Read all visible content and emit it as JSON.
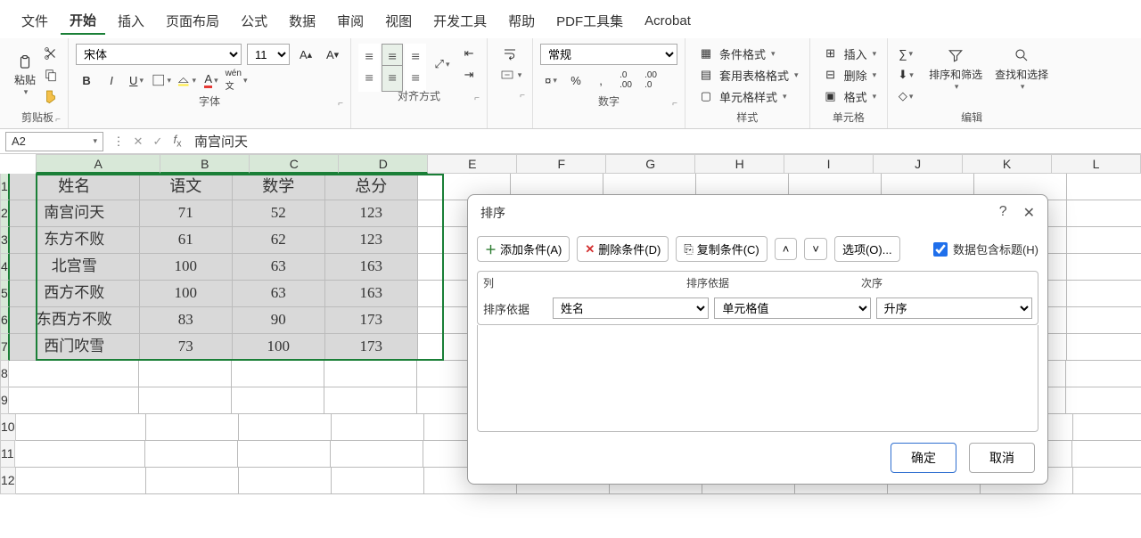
{
  "tabs": [
    "文件",
    "开始",
    "插入",
    "页面布局",
    "公式",
    "数据",
    "审阅",
    "视图",
    "开发工具",
    "帮助",
    "PDF工具集",
    "Acrobat"
  ],
  "activeTab": "开始",
  "ribbon": {
    "clipboard": {
      "paste": "粘贴",
      "label": "剪贴板"
    },
    "font": {
      "name": "宋体",
      "size": "11",
      "label": "字体"
    },
    "align": {
      "label": "对齐方式"
    },
    "number": {
      "format": "常规",
      "label": "数字"
    },
    "styles": {
      "cond": "条件格式",
      "table": "套用表格格式",
      "cell": "单元格样式",
      "label": "样式"
    },
    "cells": {
      "insert": "插入",
      "delete": "删除",
      "format": "格式",
      "label": "单元格"
    },
    "edit": {
      "sort": "排序和筛选",
      "find": "查找和选择",
      "label": "编辑"
    }
  },
  "namebox": "A2",
  "formula": "南宫问天",
  "columns": [
    "A",
    "B",
    "C",
    "D",
    "E",
    "F",
    "G",
    "H",
    "I",
    "J",
    "K",
    "L"
  ],
  "rows": [
    "1",
    "2",
    "3",
    "4",
    "5",
    "6",
    "7",
    "8",
    "9",
    "10",
    "11",
    "12"
  ],
  "data": [
    [
      "姓名",
      "语文",
      "数学",
      "总分"
    ],
    [
      "南宫问天",
      "71",
      "52",
      "123"
    ],
    [
      "东方不败",
      "61",
      "62",
      "123"
    ],
    [
      "北宫雪",
      "100",
      "63",
      "163"
    ],
    [
      "西方不败",
      "100",
      "63",
      "163"
    ],
    [
      "东西方不败",
      "83",
      "90",
      "173"
    ],
    [
      "西门吹雪",
      "73",
      "100",
      "173"
    ]
  ],
  "dialog": {
    "title": "排序",
    "add": "添加条件(A)",
    "del": "删除条件(D)",
    "copy": "复制条件(C)",
    "options": "选项(O)...",
    "hasHeader": "数据包含标题(H)",
    "colLabel": "列",
    "basisLabel": "排序依据",
    "orderLabel": "次序",
    "rowLabel": "排序依据",
    "colVal": "姓名",
    "basisVal": "单元格值",
    "orderVal": "升序",
    "ok": "确定",
    "cancel": "取消"
  }
}
